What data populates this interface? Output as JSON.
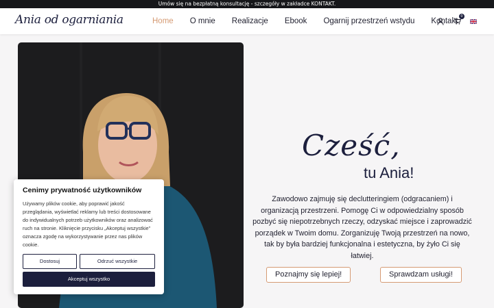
{
  "topbar": {
    "text": "Umów się na bezpłatną konsultację - szczegóły w zakładce KONTAKT."
  },
  "logo": {
    "text": "Ania od ogarniania"
  },
  "nav": {
    "items": [
      {
        "label": "Home",
        "active": true
      },
      {
        "label": "O mnie"
      },
      {
        "label": "Realizacje"
      },
      {
        "label": "Ebook"
      },
      {
        "label": "Ogarnij przestrzeń wstydu"
      },
      {
        "label": "Kontakt"
      }
    ],
    "cart_count": "0"
  },
  "hero": {
    "greeting": "Cześć,",
    "subgreeting": "tu Ania!",
    "description": "Zawodowo zajmuję się declutteringiem (odgracaniem) i organizacją przestrzeni. Pomogę Ci w odpowiedzialny sposób pozbyć się niepotrzebnych rzeczy, odzyskać miejsce i zaprowadzić porządek w Twoim domu. Zorganizuję Twoją przestrzeń na nowo, tak by była bardziej funkcjonalna i estetyczna, by żyło Ci się łatwiej.",
    "cta_primary": "Poznajmy się lepiej!",
    "cta_secondary": "Sprawdzam usługi!"
  },
  "cookie": {
    "title": "Cenimy prywatność użytkowników",
    "body": "Używamy plików cookie, aby poprawić jakość przeglądania, wyświetlać reklamy lub treści dostosowane do indywidualnych potrzeb użytkowników oraz analizować ruch na stronie. Kliknięcie przycisku „Akceptuj wszystkie” oznacza zgodę na wykorzystywanie przez nas plików cookie.",
    "customize": "Dostosuj",
    "reject": "Odrzuć wszystkie",
    "accept": "Akceptuj wszystko"
  },
  "colors": {
    "accent": "#d59a73",
    "navy": "#1c1f3d",
    "topbar": "#16171a"
  },
  "icons": [
    "user-icon",
    "cart-icon",
    "uk-flag-icon"
  ]
}
